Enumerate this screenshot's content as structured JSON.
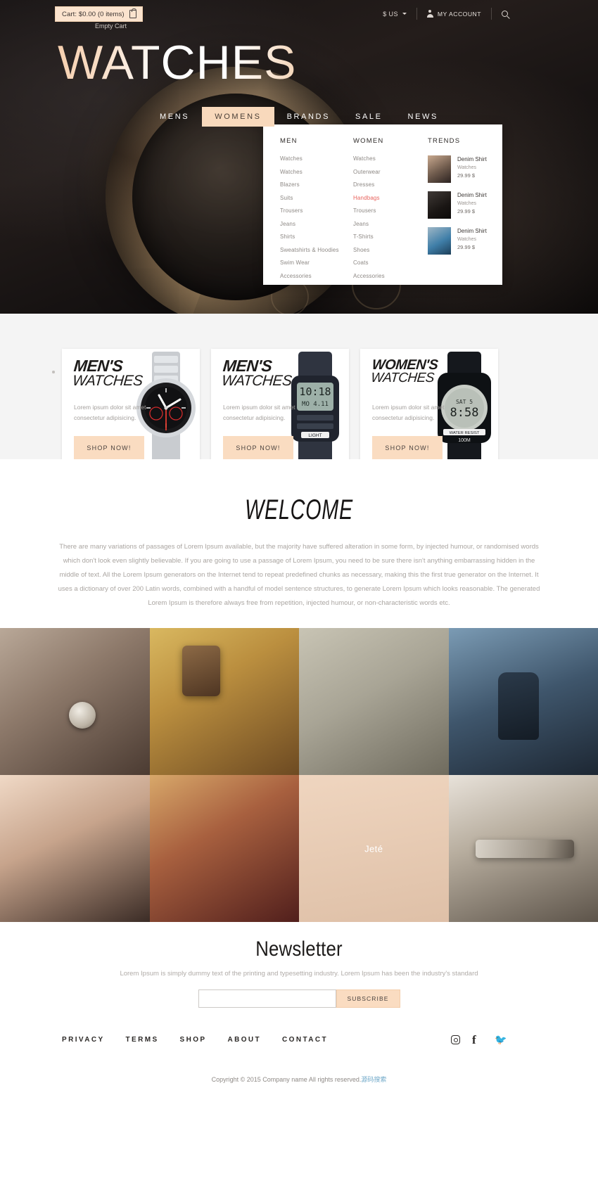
{
  "topbar": {
    "cart_label": "Cart: $0.00 (0 items)",
    "empty_cart": "Empty Cart",
    "currency": "$ US",
    "account": "MY ACCOUNT"
  },
  "logo": "WATCHES",
  "nav": [
    {
      "label": "MENS",
      "active": false
    },
    {
      "label": "WOMENS",
      "active": true
    },
    {
      "label": "BRANDS",
      "active": false
    },
    {
      "label": "SALE",
      "active": false
    },
    {
      "label": "NEWS",
      "active": false
    }
  ],
  "mega": {
    "men_title": "MEN",
    "women_title": "WOMEN",
    "trends_title": "TRENDS",
    "men": [
      "Watches",
      "Watches",
      "Blazers",
      "Suits",
      "Trousers",
      "Jeans",
      "Shirts",
      "Sweatshirts & Hoodies",
      "Swim Wear",
      "Accessories"
    ],
    "women": [
      "Watches",
      "Outerwear",
      "Dresses",
      "Handbags",
      "Trousers",
      "Jeans",
      "T-Shirts",
      "Shoes",
      "Coats",
      "Accessories"
    ],
    "highlight": "Handbags",
    "trends": [
      {
        "name": "Denim Shirt",
        "cat": "Watches",
        "price": "29.99 $"
      },
      {
        "name": "Denim Shirt",
        "cat": "Watches",
        "price": "29.99 $"
      },
      {
        "name": "Denim Shirt",
        "cat": "Watches",
        "price": "29.99 $"
      }
    ]
  },
  "cards": [
    {
      "line1": "MEN'S",
      "line2": "WATCHES",
      "desc": "Lorem ipsum dolor sit amet consectetur adipisicing.",
      "button": "SHOP NOW!"
    },
    {
      "line1": "MEN'S",
      "line2": "WATCHES",
      "desc": "Lorem ipsum dolor sit amet consectetur adipisicing.",
      "button": "SHOP NOW!"
    },
    {
      "line1": "WOMEN'S",
      "line2": "WATCHES",
      "desc": "Lorem ipsum dolor sit amet consectetur adipisicing.",
      "button": "SHOP NOW!"
    }
  ],
  "welcome": {
    "title": "WELCOME",
    "text": "There are many variations of passages of Lorem Ipsum available, but the majority have suffered alteration in some form, by injected humour, or randomised words which don't look even slightly believable. If you are going to use a passage of Lorem Ipsum, you need to be sure there isn't anything embarrassing hidden in the middle of text. All the Lorem Ipsum generators on the Internet tend to repeat predefined chunks as necessary, making this the first true generator on the Internet. It uses a dictionary of over 200 Latin words, combined with a handful of model sentence structures, to generate Lorem Ipsum which looks reasonable. The generated Lorem Ipsum is therefore always free from repetition, injected humour, or non-characteristic words etc."
  },
  "gallery": {
    "overlay_label": "Jeté"
  },
  "newsletter": {
    "title": "Newsletter",
    "subtitle": "Lorem Ipsum is simply dummy text of the printing and typesetting industry. Lorem Ipsum has been the industry's standard",
    "input_placeholder": "",
    "submit": "SUBSCRIBE"
  },
  "footer": {
    "links": [
      "PRIVACY",
      "TERMS",
      "SHOP",
      "ABOUT",
      "CONTACT"
    ],
    "copyright": "Copyright © 2015 Company name All rights reserved.",
    "copyright_suffix": "源码搜索"
  }
}
